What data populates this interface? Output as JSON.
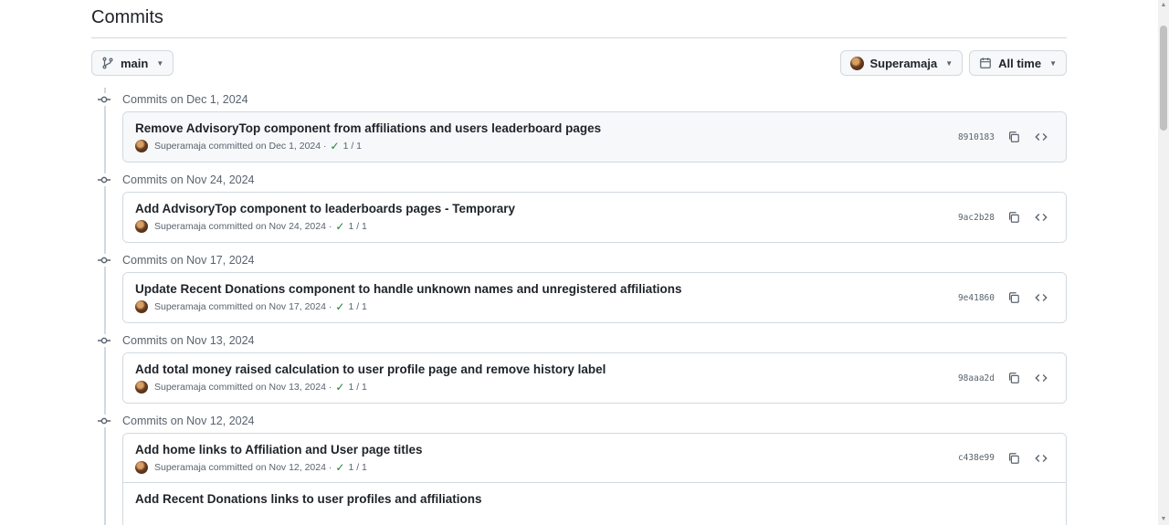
{
  "page": {
    "title": "Commits"
  },
  "toolbar": {
    "branch_label": "main",
    "author_label": "Superamaja",
    "time_label": "All time"
  },
  "groups": [
    {
      "heading": "Commits on Dec 1, 2024",
      "commits": [
        {
          "message": "Remove AdvisoryTop component from affiliations and users leaderboard pages",
          "author": "Superamaja",
          "meta": "committed on Dec 1, 2024 ·",
          "status": "1 / 1",
          "sha": "8910183"
        }
      ]
    },
    {
      "heading": "Commits on Nov 24, 2024",
      "commits": [
        {
          "message": "Add AdvisoryTop component to leaderboards pages - Temporary",
          "author": "Superamaja",
          "meta": "committed on Nov 24, 2024 ·",
          "status": "1 / 1",
          "sha": "9ac2b28"
        }
      ]
    },
    {
      "heading": "Commits on Nov 17, 2024",
      "commits": [
        {
          "message": "Update Recent Donations component to handle unknown names and unregistered affiliations",
          "author": "Superamaja",
          "meta": "committed on Nov 17, 2024 ·",
          "status": "1 / 1",
          "sha": "9e41860"
        }
      ]
    },
    {
      "heading": "Commits on Nov 13, 2024",
      "commits": [
        {
          "message": "Add total money raised calculation to user profile page and remove history label",
          "author": "Superamaja",
          "meta": "committed on Nov 13, 2024 ·",
          "status": "1 / 1",
          "sha": "98aaa2d"
        }
      ]
    },
    {
      "heading": "Commits on Nov 12, 2024",
      "commits": [
        {
          "message": "Add home links to Affiliation and User page titles",
          "author": "Superamaja",
          "meta": "committed on Nov 12, 2024 ·",
          "status": "1 / 1",
          "sha": "c438e99"
        },
        {
          "message": "Add Recent Donations links to user profiles and affiliations",
          "author": "",
          "meta": "",
          "status": "",
          "sha": ""
        }
      ]
    }
  ],
  "icons": {
    "branch": "git-branch-icon",
    "calendar": "calendar-icon",
    "commit_node": "git-commit-icon",
    "check": "check-icon",
    "copy": "copy-icon",
    "browse": "code-icon"
  },
  "colors": {
    "success": "#1a7f37",
    "border": "#d1d9e0",
    "muted": "#59636e"
  }
}
